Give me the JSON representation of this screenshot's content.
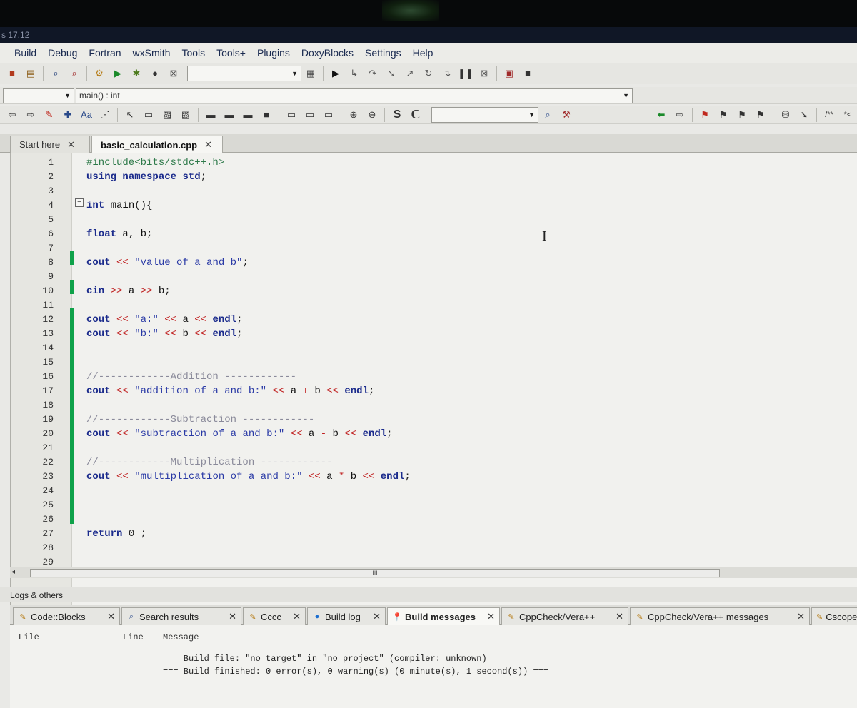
{
  "window": {
    "title_fragment": "s 17.12"
  },
  "menu": [
    "Build",
    "Debug",
    "Fortran",
    "wxSmith",
    "Tools",
    "Tools+",
    "Plugins",
    "DoxyBlocks",
    "Settings",
    "Help"
  ],
  "scope_bar": {
    "symbol": "main() : int"
  },
  "editor_tabs": [
    {
      "label": "Start here",
      "active": false
    },
    {
      "label": "basic_calculation.cpp",
      "active": true
    }
  ],
  "code_lines": [
    {
      "n": "1",
      "text": "#include<bits/stdc++.h>"
    },
    {
      "n": "2",
      "text": "using namespace std;"
    },
    {
      "n": "3",
      "text": ""
    },
    {
      "n": "4",
      "text": "int main(){"
    },
    {
      "n": "5",
      "text": ""
    },
    {
      "n": "6",
      "text": "float a, b;"
    },
    {
      "n": "7",
      "text": ""
    },
    {
      "n": "8",
      "text": "cout << \"value of a and b\";"
    },
    {
      "n": "9",
      "text": ""
    },
    {
      "n": "10",
      "text": "cin >> a >> b;"
    },
    {
      "n": "11",
      "text": ""
    },
    {
      "n": "12",
      "text": "cout << \"a:\" << a << endl;"
    },
    {
      "n": "13",
      "text": "cout << \"b:\" << b << endl;"
    },
    {
      "n": "14",
      "text": ""
    },
    {
      "n": "15",
      "text": ""
    },
    {
      "n": "16",
      "text": "//------------Addition ------------"
    },
    {
      "n": "17",
      "text": "cout << \"addition of a and b:\" << a + b << endl;"
    },
    {
      "n": "18",
      "text": ""
    },
    {
      "n": "19",
      "text": "//------------Subtraction ------------"
    },
    {
      "n": "20",
      "text": "cout << \"subtraction of a and b:\" << a - b << endl;"
    },
    {
      "n": "21",
      "text": ""
    },
    {
      "n": "22",
      "text": "//------------Multiplication ------------"
    },
    {
      "n": "23",
      "text": "cout << \"multiplication of a and b:\" << a * b << endl;"
    },
    {
      "n": "24",
      "text": ""
    },
    {
      "n": "25",
      "text": ""
    },
    {
      "n": "26",
      "text": ""
    },
    {
      "n": "27",
      "text": "return 0 ;"
    },
    {
      "n": "28",
      "text": ""
    },
    {
      "n": "29",
      "text": ""
    }
  ],
  "scrollbar": {
    "thumb_grip": "III"
  },
  "logs": {
    "title": "Logs & others",
    "tabs": [
      {
        "label": "Code::Blocks"
      },
      {
        "label": "Search results"
      },
      {
        "label": "Cccc"
      },
      {
        "label": "Build log"
      },
      {
        "label": "Build messages"
      },
      {
        "label": "CppCheck/Vera++"
      },
      {
        "label": "CppCheck/Vera++ messages"
      },
      {
        "label": "Cscope"
      }
    ],
    "columns": {
      "file": "File",
      "line": "Line",
      "message": "Message"
    },
    "messages": [
      "=== Build file: \"no target\" in \"no project\" (compiler: unknown) ===",
      "=== Build finished: 0 error(s), 0 warning(s) (0 minute(s), 1 second(s)) ==="
    ]
  }
}
